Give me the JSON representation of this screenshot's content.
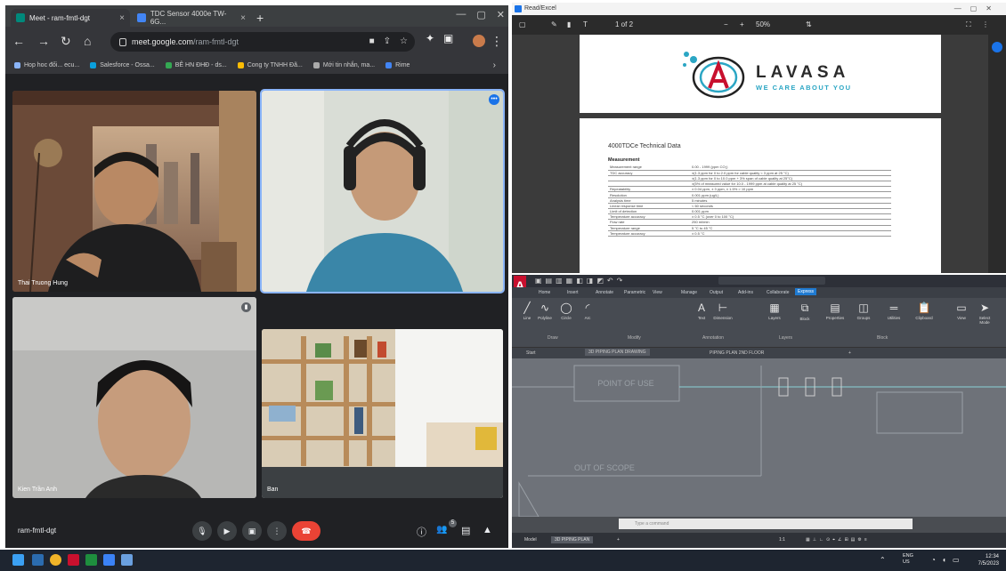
{
  "browser": {
    "tabs": [
      {
        "label": "Meet - ram-fmtl-dgt",
        "close": "×"
      },
      {
        "label": "TDC Sensor 4000e TW-6G...",
        "close": "×"
      }
    ],
    "new_tab": "+",
    "window_controls": [
      "—",
      "▢",
      "✕"
    ],
    "url_host": "meet.google.com",
    "url_path": "/ram-fmtl-dgt",
    "bookmarks": [
      "Hop hoc đối... ecu...",
      "Salesforce - Ossa...",
      "BÊ HN ĐHĐ - ds...",
      "Cong ty TNHH Đã...",
      "Mới tin nhắn, ma...",
      "Rime"
    ],
    "bookmarks_more": "›",
    "accent": "#8ab4f8"
  },
  "meet": {
    "participants": [
      {
        "name": "Thai Truong Hung"
      },
      {
        "name": ""
      },
      {
        "name": "Kien Trần Anh"
      },
      {
        "name": "Ban"
      }
    ],
    "more_badge": "•••",
    "meeting_code": "ram-fmtl-dgt",
    "controls": {
      "mic": "🎙",
      "camera": "▶",
      "present": "▣",
      "more": "⋮",
      "end": "☎"
    },
    "right_controls": {
      "info": "ⓘ",
      "people": "👥",
      "chat": "▤",
      "activities": "▲"
    },
    "people_count": "5",
    "end_color": "#ea4335"
  },
  "pdf_viewer": {
    "window_title": "Read/Excel",
    "window_controls": "—▢✕",
    "zoom": "50%",
    "page_info": "1 of 2",
    "logo": {
      "name": "LAVASA",
      "tagline": "WE CARE ABOUT YOU"
    },
    "doc_title": "4000TDCe Technical Data",
    "section": "Measurement",
    "specs": [
      [
        "Measurement range",
        "0.00 - 1999 (ppm CO₂)"
      ],
      [
        "TDC accuracy",
        "±(1.3 ppm for 0 to 2.0 ppm for cable quality < 3 ppm at 25 °C)"
      ],
      [
        "",
        "±(1.3 ppm for 0 to 10.0 ppm + 3% span of cable quality at 25°C)"
      ],
      [
        "",
        "±(5% of measured value for 10.0 - 1999 ppm at cable quality at 25 °C)"
      ],
      [
        "Repeatability",
        "± 0.04 ppm, ± 3 ppm, ± 1.5% > 10 ppm"
      ],
      [
        "Resolution",
        "0.001 ppm (ug/L)"
      ],
      [
        "Analysis time",
        "5 minutes"
      ],
      [
        "Linear response time",
        "< 60 seconds"
      ],
      [
        "Limit of detection",
        "0.001 ppm"
      ],
      [
        "Temperature accuracy",
        "± 0.5 °C (over 0 to 100 °C)"
      ],
      [
        "Flow rate",
        "250 ml/min"
      ],
      [
        "Temperature range",
        "5 °C to 45 °C"
      ],
      [
        "Temperature accuracy",
        "± 0.5 °C"
      ]
    ]
  },
  "cad": {
    "app_letter": "A",
    "tabs": [
      "Home",
      "Insert",
      "Annotate",
      "Parametric",
      "View",
      "Manage",
      "Output",
      "Add-ins",
      "Collaborate",
      "Express"
    ],
    "active_tab": "Express",
    "tools": [
      {
        "icon": "╱",
        "label": "Line"
      },
      {
        "icon": "∿",
        "label": "Polyline"
      },
      {
        "icon": "◯",
        "label": "Circle"
      },
      {
        "icon": "◜",
        "label": "Arc"
      },
      {
        "icon": "A",
        "label": "Text"
      },
      {
        "icon": "⊢",
        "label": "Dimension"
      },
      {
        "icon": "▦",
        "label": "Layers"
      },
      {
        "icon": "⧉",
        "label": "Block"
      },
      {
        "icon": "▤",
        "label": "Properties"
      },
      {
        "icon": "◫",
        "label": "Groups"
      },
      {
        "icon": "═",
        "label": "Utilities"
      },
      {
        "icon": "📋",
        "label": "Clipboard"
      },
      {
        "icon": "▭",
        "label": "View"
      },
      {
        "icon": "➤",
        "label": "Select Mode"
      }
    ],
    "panels": [
      "Draw",
      "Modify",
      "Annotation",
      "Layers",
      "Block"
    ],
    "doc_tabs": [
      "Start",
      "3D PIPING PLAN DRAWING",
      "PIPING PLAN 2ND FLOOR"
    ],
    "drawing_labels": [
      "POINT OF USE",
      "OUT OF SCOPE"
    ],
    "command_placeholder": "Type a command",
    "layout_tabs": [
      "Model",
      "3D PIPING PLAN"
    ],
    "status_scale": "1:1"
  },
  "taskbar": {
    "time": "12:34",
    "date": "7/5/2023",
    "lang": "ENG\nUS"
  }
}
